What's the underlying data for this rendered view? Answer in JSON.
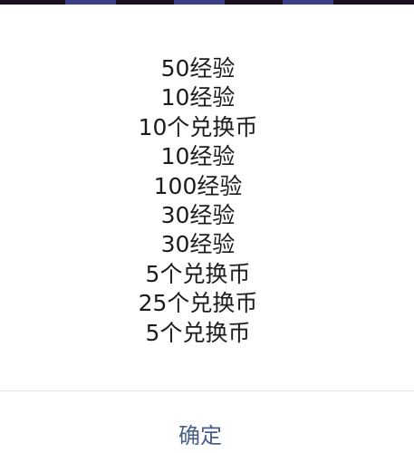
{
  "dialog": {
    "rewards": [
      "50经验",
      "10经验",
      "10个兑换币",
      "10经验",
      "100经验",
      "30经验",
      "30经验",
      "5个兑换币",
      "25个兑换币",
      "5个兑换币"
    ],
    "confirm_label": "确定"
  },
  "colors": {
    "accent": "#4a5f86",
    "text": "#1c1c1c",
    "divider": "#e4e4e4",
    "backdrop_strip": "#1a1020"
  }
}
